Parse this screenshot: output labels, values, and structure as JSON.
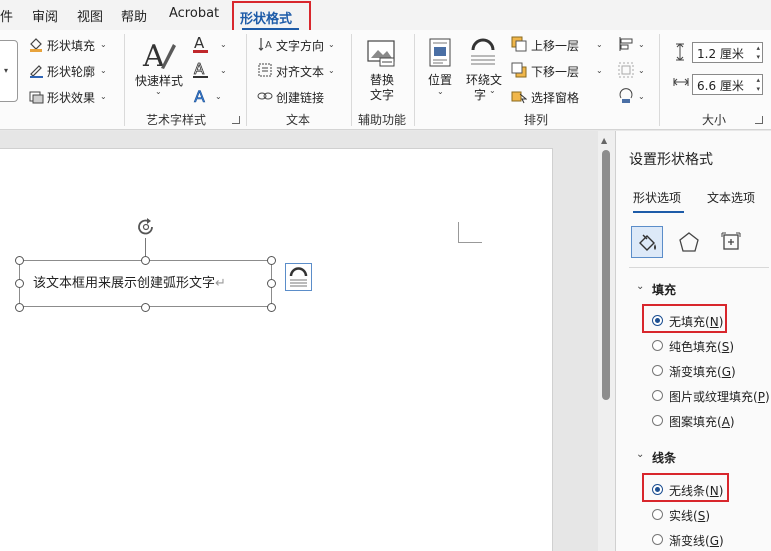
{
  "menu": {
    "tabs": [
      "件",
      "审阅",
      "视图",
      "帮助",
      "Acrobat"
    ],
    "active_tab": "形状格式"
  },
  "ribbon": {
    "shape_styles": {
      "fill": "形状填充",
      "outline": "形状轮廓",
      "effects": "形状效果"
    },
    "wordart": {
      "quick_styles": "快速样式",
      "label": "艺术字样式"
    },
    "text": {
      "direction": "文字方向",
      "align": "对齐文本",
      "link": "创建链接",
      "label": "文本"
    },
    "accessibility": {
      "alt_text_line1": "替换",
      "alt_text_line2": "文字",
      "label": "辅助功能"
    },
    "arrange": {
      "position": "位置",
      "wrap_line1": "环绕文",
      "wrap_line2": "字",
      "bring_forward": "上移一层",
      "send_backward": "下移一层",
      "selection_pane": "选择窗格",
      "label": "排列"
    },
    "size": {
      "height": "1.2 厘米",
      "width": "6.6 厘米",
      "label": "大小"
    }
  },
  "document": {
    "textbox_text": "该文本框用来展示创建弧形文字",
    "paragraph_mark": "↵"
  },
  "pane": {
    "title": "设置形状格式",
    "tab_shape": "形状选项",
    "tab_text": "文本选项",
    "fill_header": "填充",
    "fill_options": [
      {
        "label": "无填充",
        "key": "N",
        "selected": true
      },
      {
        "label": "纯色填充",
        "key": "S",
        "selected": false
      },
      {
        "label": "渐变填充",
        "key": "G",
        "selected": false
      },
      {
        "label": "图片或纹理填充",
        "key": "P",
        "selected": false
      },
      {
        "label": "图案填充",
        "key": "A",
        "selected": false
      }
    ],
    "line_header": "线条",
    "line_options": [
      {
        "label": "无线条",
        "key": "N",
        "selected": true
      },
      {
        "label": "实线",
        "key": "S",
        "selected": false
      },
      {
        "label": "渐变线",
        "key": "G",
        "selected": false
      }
    ]
  },
  "colors": {
    "accent": "#1d5ba8",
    "highlight": "#d8262c",
    "wordart_red": "#c0282c"
  },
  "icons": [
    "fill-bucket-icon",
    "pentagon-icon",
    "layout-size-icon",
    "rotate-handle-icon",
    "layout-options-icon",
    "arc-text-icon"
  ]
}
